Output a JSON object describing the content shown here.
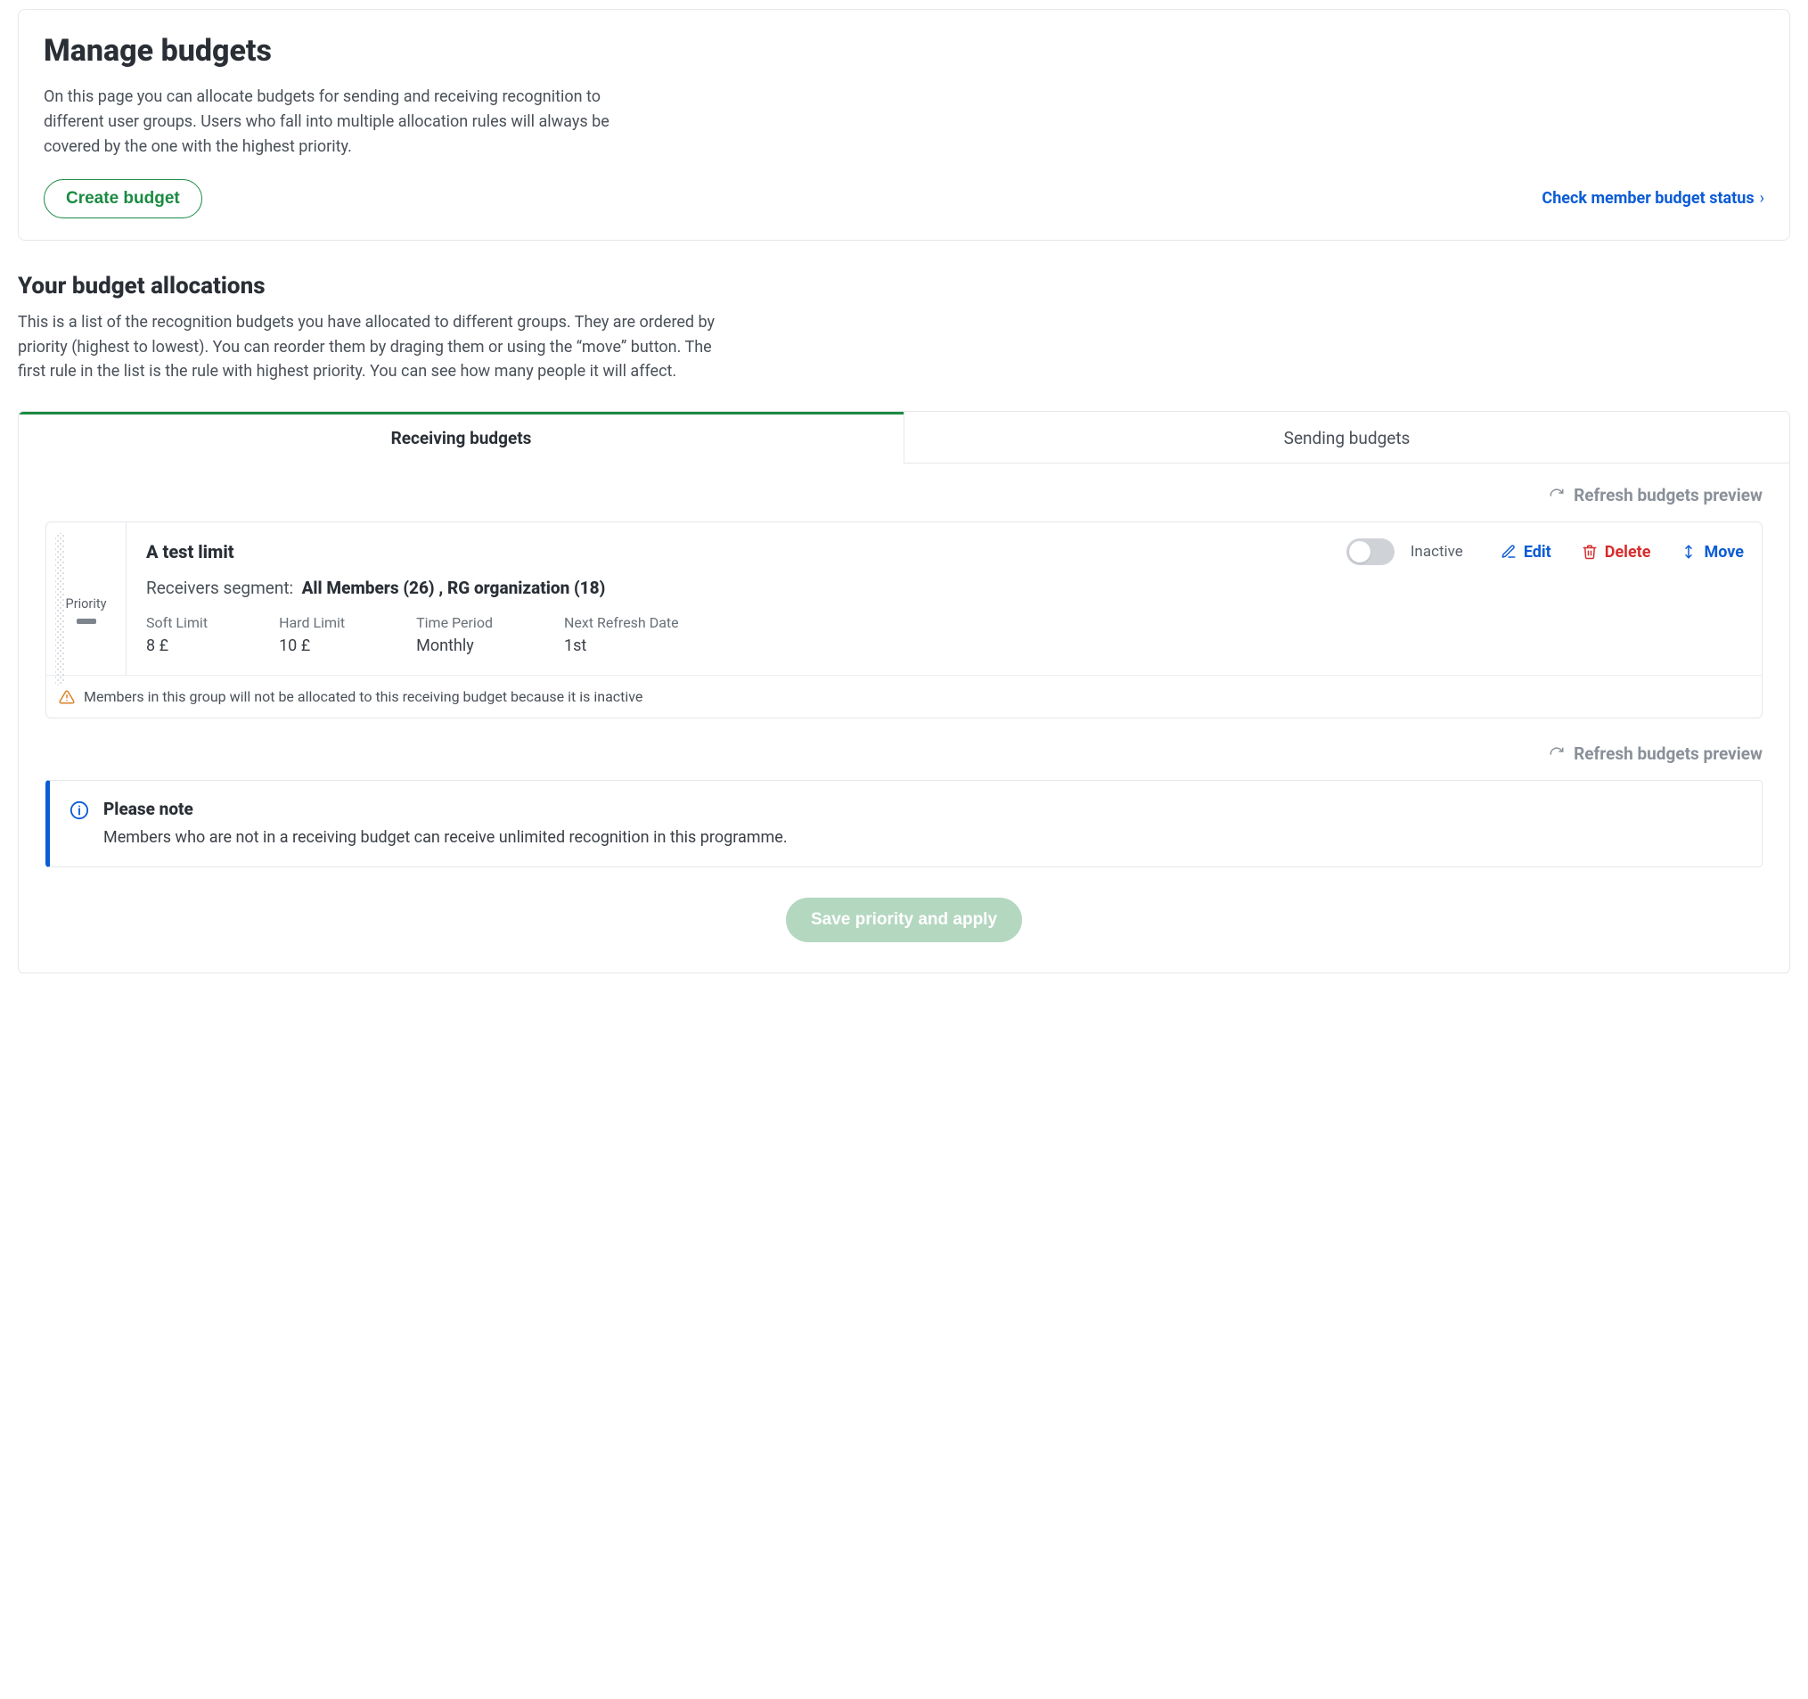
{
  "header": {
    "title": "Manage budgets",
    "description": "On this page you can allocate budgets for sending and receiving recognition to different user groups. Users who fall into multiple allocation rules will always be covered by the one with the highest priority.",
    "create_button": "Create budget",
    "check_link": "Check member budget status"
  },
  "allocations_section": {
    "title": "Your budget allocations",
    "description": "This is a list of the recognition budgets you have allocated to different groups. They are ordered by priority (highest to lowest). You can reorder them by draging them or using the “move” button. The first rule in the list is the rule with highest priority. You can see how many people it will affect."
  },
  "tabs": {
    "receiving": "Receiving budgets",
    "sending": "Sending budgets"
  },
  "refresh_label": "Refresh budgets preview",
  "priority_label": "Priority",
  "allocation": {
    "title": "A test limit",
    "toggle_status": "Inactive",
    "actions": {
      "edit": "Edit",
      "delete": "Delete",
      "move": "Move"
    },
    "segment_label": "Receivers segment:",
    "segment_value": "All Members (26) , RG organization (18)",
    "limits": {
      "soft_label": "Soft Limit",
      "soft_value": "8 £",
      "hard_label": "Hard Limit",
      "hard_value": "10 £",
      "period_label": "Time Period",
      "period_value": "Monthly",
      "refresh_label": "Next Refresh Date",
      "refresh_value": "1st"
    },
    "warning": "Members in this group will not be allocated to this receiving budget because it is inactive"
  },
  "note": {
    "title": "Please note",
    "body": "Members who are not in a receiving budget can receive unlimited recognition in this programme."
  },
  "save_button": "Save priority and apply",
  "colors": {
    "green": "#1b8a42",
    "blue": "#0b5cd6",
    "red": "#d62d2d",
    "warn": "#d9822b",
    "save_disabled_bg": "#b4d7c0"
  }
}
